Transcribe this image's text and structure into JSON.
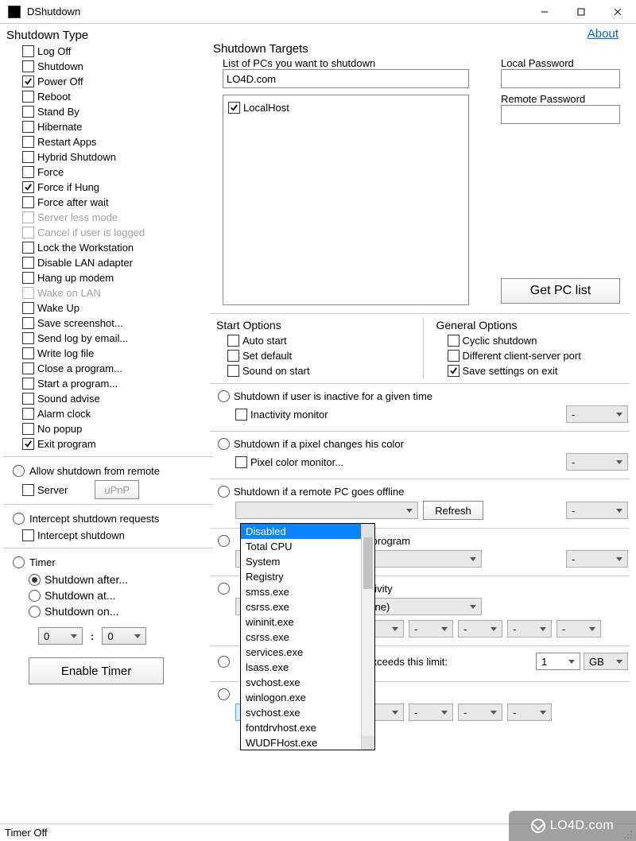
{
  "titlebar": {
    "title": "DShutdown"
  },
  "about": "About",
  "shutdown_type": {
    "title": "Shutdown Type",
    "items": [
      {
        "label": "Log Off",
        "checked": false,
        "disabled": false
      },
      {
        "label": "Shutdown",
        "checked": false,
        "disabled": false
      },
      {
        "label": "Power Off",
        "checked": true,
        "disabled": false
      },
      {
        "label": "Reboot",
        "checked": false,
        "disabled": false
      },
      {
        "label": "Stand By",
        "checked": false,
        "disabled": false
      },
      {
        "label": "Hibernate",
        "checked": false,
        "disabled": false
      },
      {
        "label": "Restart Apps",
        "checked": false,
        "disabled": false
      },
      {
        "label": "Hybrid Shutdown",
        "checked": false,
        "disabled": false
      },
      {
        "label": "Force",
        "checked": false,
        "disabled": false
      },
      {
        "label": "Force if Hung",
        "checked": true,
        "disabled": false
      },
      {
        "label": "Force after wait",
        "checked": false,
        "disabled": false
      },
      {
        "label": "Server less mode",
        "checked": false,
        "disabled": true
      },
      {
        "label": "Cancel if user is logged",
        "checked": false,
        "disabled": true
      },
      {
        "label": "Lock the Workstation",
        "checked": false,
        "disabled": false
      },
      {
        "label": "Disable LAN adapter",
        "checked": false,
        "disabled": false
      },
      {
        "label": "Hang up modem",
        "checked": false,
        "disabled": false
      },
      {
        "label": "Wake on LAN",
        "checked": false,
        "disabled": true
      },
      {
        "label": "Wake Up",
        "checked": false,
        "disabled": false
      },
      {
        "label": "Save screenshot...",
        "checked": false,
        "disabled": false
      },
      {
        "label": "Send log by email...",
        "checked": false,
        "disabled": false
      },
      {
        "label": "Write log file",
        "checked": false,
        "disabled": false
      },
      {
        "label": "Close a program...",
        "checked": false,
        "disabled": false
      },
      {
        "label": "Start a program...",
        "checked": false,
        "disabled": false
      },
      {
        "label": "Sound advise",
        "checked": false,
        "disabled": false
      },
      {
        "label": "Alarm clock",
        "checked": false,
        "disabled": false
      },
      {
        "label": "No popup",
        "checked": false,
        "disabled": false
      },
      {
        "label": "Exit program",
        "checked": true,
        "disabled": false
      }
    ]
  },
  "allow_remote": {
    "title": "Allow shutdown from remote",
    "server_opt": "Server",
    "upnp": "uPnP"
  },
  "intercept": {
    "title": "Intercept shutdown requests",
    "opt": "Intercept shutdown"
  },
  "timer": {
    "title": "Timer",
    "after": "Shutdown after...",
    "at": "Shutdown at...",
    "on": "Shutdown on...",
    "hour": "0",
    "minute": "0",
    "enable": "Enable Timer"
  },
  "targets": {
    "title": "Shutdown Targets",
    "list_label": "List of PCs you want to shutdown",
    "input": "LO4D.com",
    "host": "LocalHost",
    "local_pw": "Local Password",
    "remote_pw": "Remote Password",
    "get_list": "Get PC list"
  },
  "start_options": {
    "title": "Start Options",
    "items": [
      {
        "label": "Auto start",
        "checked": false
      },
      {
        "label": "Set default",
        "checked": false
      },
      {
        "label": "Sound on start",
        "checked": false
      }
    ]
  },
  "general_options": {
    "title": "General Options",
    "items": [
      {
        "label": "Cyclic shutdown",
        "checked": false
      },
      {
        "label": "Different client-server port",
        "checked": false
      },
      {
        "label": "Save settings on exit",
        "checked": true
      }
    ]
  },
  "cond1": {
    "title": "Shutdown if user is inactive for a given time",
    "opt": "Inactivity monitor",
    "sel": "-"
  },
  "cond2": {
    "title": "Shutdown if a pixel changes his color",
    "opt": "Pixel color monitor...",
    "sel": "-"
  },
  "cond3": {
    "title": "Shutdown if a remote PC goes offline",
    "refresh": "Refresh",
    "sel": "-",
    "dd": ""
  },
  "cond4": {
    "title_suffix": " program",
    "dd": "",
    "sel": "-"
  },
  "cond5": {
    "title_suffix": "tivity",
    "dd": "MM Protocol TDI) (Other Offline)",
    "s1": "-",
    "s2": "-",
    "s3": "-",
    "s4": "-",
    "s5": "-"
  },
  "cond6": {
    "title_suffix": "xceeds this limit:",
    "n": "1",
    "unit": "GB"
  },
  "cond7": {
    "main": "Disabled",
    "s1": "-",
    "s2": "-",
    "s3": "-",
    "s4": "-"
  },
  "popup": {
    "items": [
      "Disabled",
      "Total CPU",
      "System",
      "Registry",
      "smss.exe",
      "csrss.exe",
      "wininit.exe",
      "csrss.exe",
      "services.exe",
      "lsass.exe",
      "svchost.exe",
      "winlogon.exe",
      "svchost.exe",
      "fontdrvhost.exe",
      "WUDFHost.exe"
    ]
  },
  "status": "Timer Off",
  "watermark": "LO4D.com"
}
